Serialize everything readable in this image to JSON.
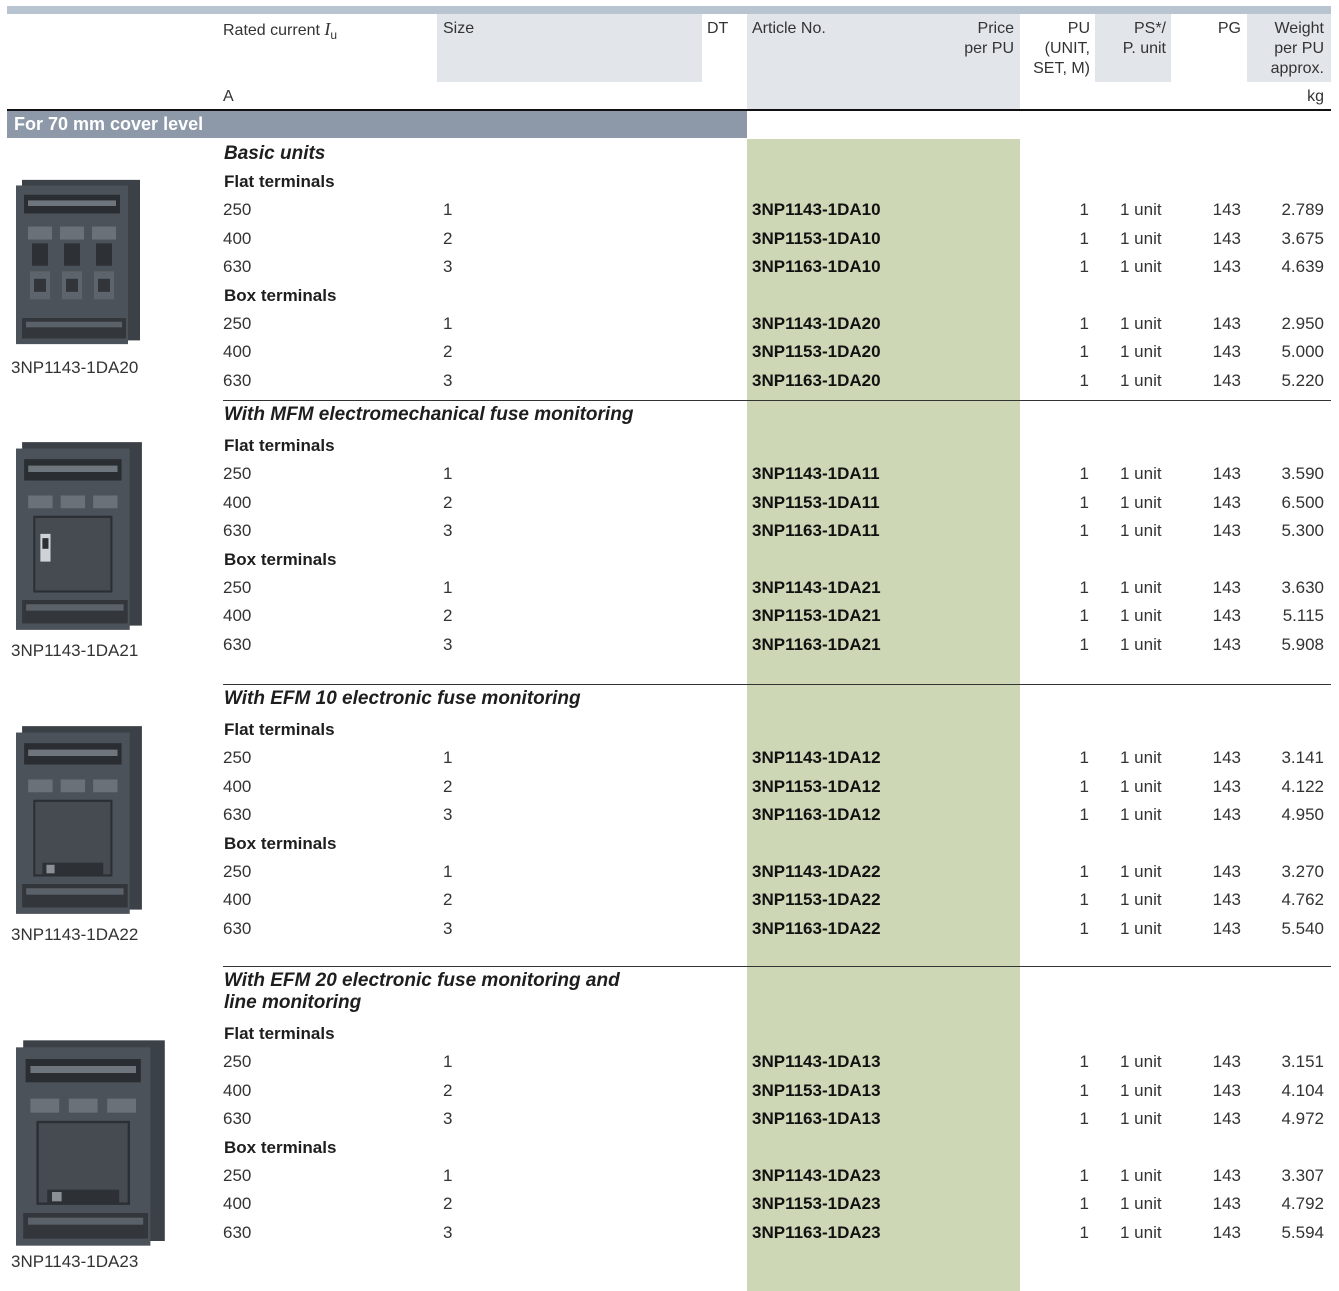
{
  "header": {
    "rated_current": "Rated current",
    "iu_symbol": "I",
    "iu_sub": "u",
    "size": "Size",
    "dt": "DT",
    "article": "Article No.",
    "price_1": "Price",
    "price_2": "per PU",
    "pu_1": "PU",
    "pu_2": "(UNIT,",
    "pu_3": "SET, M)",
    "ps_1": "PS*/",
    "ps_2": "P. unit",
    "pg": "PG",
    "weight_1": "Weight",
    "weight_2": "per PU",
    "weight_3": "approx.",
    "unit_a": "A",
    "unit_kg": "kg"
  },
  "section_title": "For 70 mm cover level",
  "groups": [
    {
      "title_lines": [
        "Basic units"
      ],
      "caption": "3NP1143-1DA20",
      "subsections": [
        {
          "label": "Flat terminals",
          "rows": [
            {
              "current": "250",
              "size": "1",
              "article": "3NP1143-1DA10",
              "pu": "1",
              "ps": "1 unit",
              "pg": "143",
              "weight": "2.789"
            },
            {
              "current": "400",
              "size": "2",
              "article": "3NP1153-1DA10",
              "pu": "1",
              "ps": "1 unit",
              "pg": "143",
              "weight": "3.675"
            },
            {
              "current": "630",
              "size": "3",
              "article": "3NP1163-1DA10",
              "pu": "1",
              "ps": "1 unit",
              "pg": "143",
              "weight": "4.639"
            }
          ]
        },
        {
          "label": "Box terminals",
          "rows": [
            {
              "current": "250",
              "size": "1",
              "article": "3NP1143-1DA20",
              "pu": "1",
              "ps": "1 unit",
              "pg": "143",
              "weight": "2.950"
            },
            {
              "current": "400",
              "size": "2",
              "article": "3NP1153-1DA20",
              "pu": "1",
              "ps": "1 unit",
              "pg": "143",
              "weight": "5.000"
            },
            {
              "current": "630",
              "size": "3",
              "article": "3NP1163-1DA20",
              "pu": "1",
              "ps": "1 unit",
              "pg": "143",
              "weight": "5.220"
            }
          ]
        }
      ]
    },
    {
      "title_lines": [
        "With MFM electromechanical fuse monitoring"
      ],
      "caption": "3NP1143-1DA21",
      "subsections": [
        {
          "label": "Flat terminals",
          "rows": [
            {
              "current": "250",
              "size": "1",
              "article": "3NP1143-1DA11",
              "pu": "1",
              "ps": "1 unit",
              "pg": "143",
              "weight": "3.590"
            },
            {
              "current": "400",
              "size": "2",
              "article": "3NP1153-1DA11",
              "pu": "1",
              "ps": "1 unit",
              "pg": "143",
              "weight": "6.500"
            },
            {
              "current": "630",
              "size": "3",
              "article": "3NP1163-1DA11",
              "pu": "1",
              "ps": "1 unit",
              "pg": "143",
              "weight": "5.300"
            }
          ]
        },
        {
          "label": "Box terminals",
          "rows": [
            {
              "current": "250",
              "size": "1",
              "article": "3NP1143-1DA21",
              "pu": "1",
              "ps": "1 unit",
              "pg": "143",
              "weight": "3.630"
            },
            {
              "current": "400",
              "size": "2",
              "article": "3NP1153-1DA21",
              "pu": "1",
              "ps": "1 unit",
              "pg": "143",
              "weight": "5.115"
            },
            {
              "current": "630",
              "size": "3",
              "article": "3NP1163-1DA21",
              "pu": "1",
              "ps": "1 unit",
              "pg": "143",
              "weight": "5.908"
            }
          ]
        }
      ]
    },
    {
      "title_lines": [
        "With EFM 10 electronic fuse monitoring"
      ],
      "caption": "3NP1143-1DA22",
      "subsections": [
        {
          "label": "Flat terminals",
          "rows": [
            {
              "current": "250",
              "size": "1",
              "article": "3NP1143-1DA12",
              "pu": "1",
              "ps": "1 unit",
              "pg": "143",
              "weight": "3.141"
            },
            {
              "current": "400",
              "size": "2",
              "article": "3NP1153-1DA12",
              "pu": "1",
              "ps": "1 unit",
              "pg": "143",
              "weight": "4.122"
            },
            {
              "current": "630",
              "size": "3",
              "article": "3NP1163-1DA12",
              "pu": "1",
              "ps": "1 unit",
              "pg": "143",
              "weight": "4.950"
            }
          ]
        },
        {
          "label": "Box terminals",
          "rows": [
            {
              "current": "250",
              "size": "1",
              "article": "3NP1143-1DA22",
              "pu": "1",
              "ps": "1 unit",
              "pg": "143",
              "weight": "3.270"
            },
            {
              "current": "400",
              "size": "2",
              "article": "3NP1153-1DA22",
              "pu": "1",
              "ps": "1 unit",
              "pg": "143",
              "weight": "4.762"
            },
            {
              "current": "630",
              "size": "3",
              "article": "3NP1163-1DA22",
              "pu": "1",
              "ps": "1 unit",
              "pg": "143",
              "weight": "5.540"
            }
          ]
        }
      ]
    },
    {
      "title_lines": [
        "With EFM 20 electronic fuse monitoring and",
        "line monitoring"
      ],
      "caption": "3NP1143-1DA23",
      "subsections": [
        {
          "label": "Flat terminals",
          "rows": [
            {
              "current": "250",
              "size": "1",
              "article": "3NP1143-1DA13",
              "pu": "1",
              "ps": "1 unit",
              "pg": "143",
              "weight": "3.151"
            },
            {
              "current": "400",
              "size": "2",
              "article": "3NP1153-1DA13",
              "pu": "1",
              "ps": "1 unit",
              "pg": "143",
              "weight": "4.104"
            },
            {
              "current": "630",
              "size": "3",
              "article": "3NP1163-1DA13",
              "pu": "1",
              "ps": "1 unit",
              "pg": "143",
              "weight": "4.972"
            }
          ]
        },
        {
          "label": "Box terminals",
          "rows": [
            {
              "current": "250",
              "size": "1",
              "article": "3NP1143-1DA23",
              "pu": "1",
              "ps": "1 unit",
              "pg": "143",
              "weight": "3.307"
            },
            {
              "current": "400",
              "size": "2",
              "article": "3NP1153-1DA23",
              "pu": "1",
              "ps": "1 unit",
              "pg": "143",
              "weight": "4.792"
            },
            {
              "current": "630",
              "size": "3",
              "article": "3NP1163-1DA23",
              "pu": "1",
              "ps": "1 unit",
              "pg": "143",
              "weight": "5.594"
            }
          ]
        }
      ]
    }
  ]
}
